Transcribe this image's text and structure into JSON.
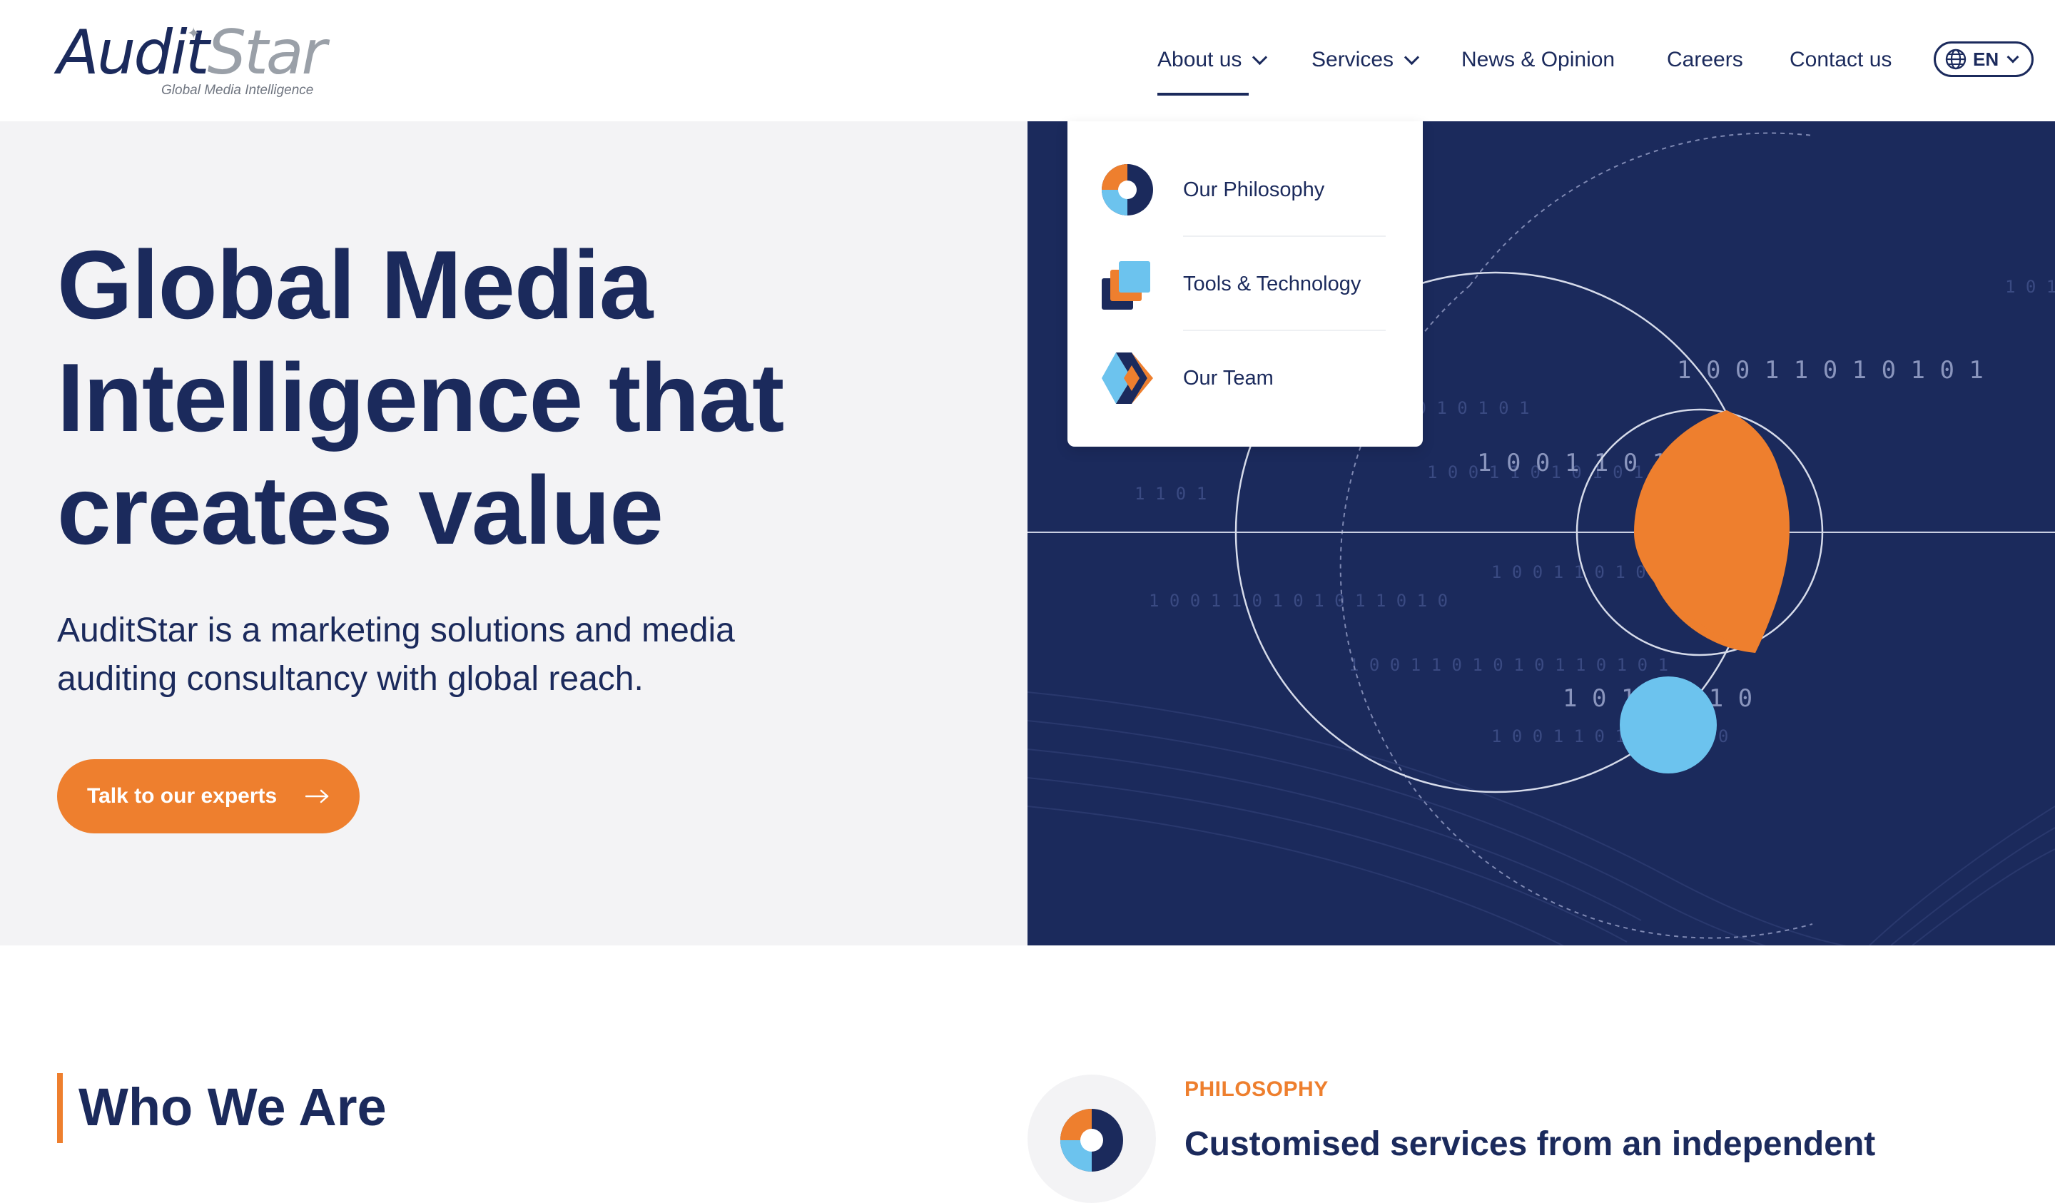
{
  "brand": {
    "logo_word_1": "Audit",
    "logo_word_2": "Star",
    "tagline": "Global Media Intelligence"
  },
  "nav": {
    "items": [
      {
        "label": "About us",
        "has_dropdown": true,
        "active": true
      },
      {
        "label": "Services",
        "has_dropdown": true,
        "active": false
      },
      {
        "label": "News & Opinion",
        "has_dropdown": false,
        "active": false
      },
      {
        "label": "Careers",
        "has_dropdown": false,
        "active": false
      },
      {
        "label": "Contact us",
        "has_dropdown": false,
        "active": false
      }
    ],
    "language": "EN",
    "language_icon": "globe-icon"
  },
  "about_dropdown": {
    "items": [
      {
        "label": "Our Philosophy",
        "icon": "philosophy-icon"
      },
      {
        "label": "Tools & Technology",
        "icon": "tools-icon"
      },
      {
        "label": "Our Team",
        "icon": "team-icon"
      }
    ]
  },
  "hero": {
    "title_line_1": "Global Media",
    "title_line_2": "Intelligence that",
    "title_line_3": "creates value",
    "subtitle_line_1": "AuditStar is a marketing solutions and media",
    "subtitle_line_2": "auditing consultancy with global reach.",
    "cta_label": "Talk to our experts",
    "cta_icon": "arrow-right-icon"
  },
  "hero_graphic": {
    "binary_rows": [
      "1 0 0 1   1 0   1 0 1 0 1",
      "1 0 0 1   1   0 1   1   0   1",
      "1   0   1   1   0   1   0"
    ]
  },
  "who": {
    "title": "Who We Are"
  },
  "philosophy": {
    "kicker": "PHILOSOPHY",
    "heading": "Customised services from an independent"
  },
  "colors": {
    "navy": "#1b2a5c",
    "orange": "#ee7f2e",
    "sky": "#6cc3ee",
    "light_bg": "#f3f3f5"
  }
}
